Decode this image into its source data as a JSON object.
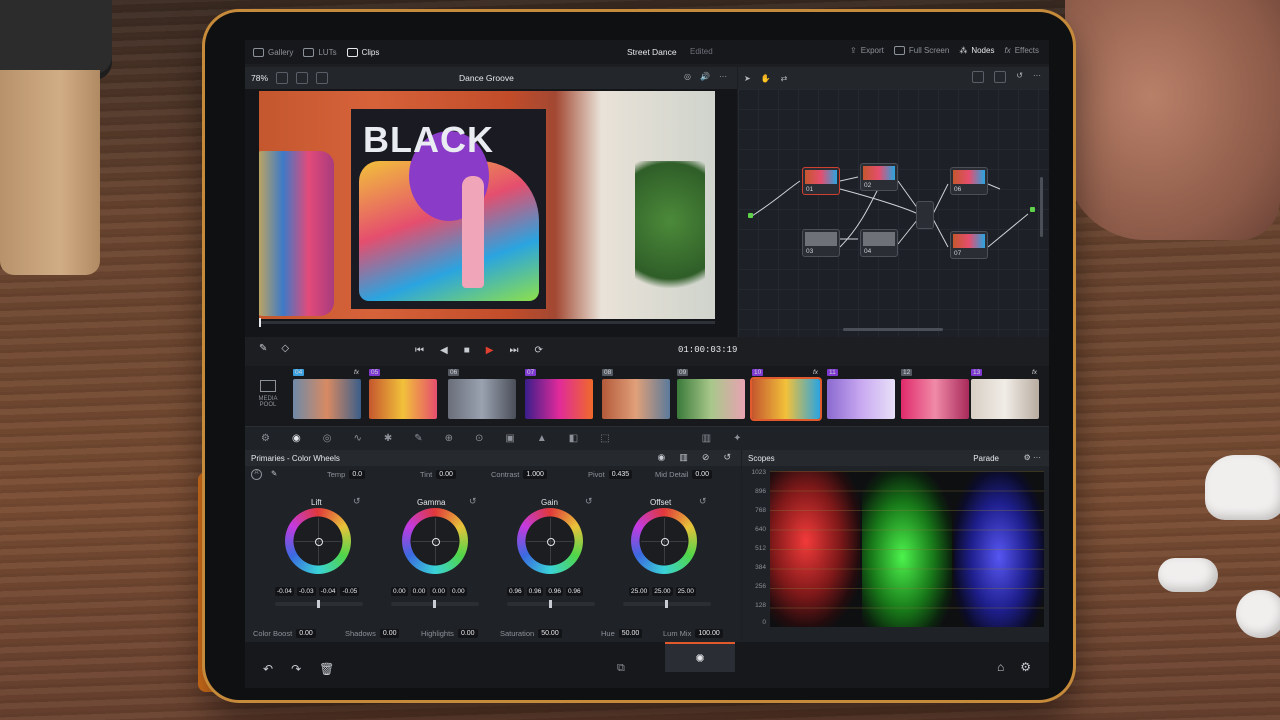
{
  "topbar": {
    "gallery": "Gallery",
    "luts": "LUTs",
    "clips": "Clips",
    "project_title": "Street Dance",
    "status": "Edited",
    "export": "Export",
    "fullscreen": "Full Screen",
    "nodes": "Nodes",
    "effects": "Effects"
  },
  "viewer": {
    "zoom": "78%",
    "clip_name": "Dance Groove",
    "timecode": "01:00:03:19",
    "mural_text": "BLACK"
  },
  "node_graph": {
    "nodes": [
      "01",
      "02",
      "03",
      "04",
      "06",
      "07"
    ]
  },
  "clips": [
    {
      "num": "04",
      "fx": "fx",
      "color": "#3aa0e0"
    },
    {
      "num": "05",
      "fx": "",
      "color": "#7e3ad0"
    },
    {
      "num": "06",
      "fx": "",
      "color": "#555a62"
    },
    {
      "num": "07",
      "fx": "",
      "color": "#7e3ad0"
    },
    {
      "num": "08",
      "fx": "",
      "color": "#555a62"
    },
    {
      "num": "09",
      "fx": "",
      "color": "#555a62"
    },
    {
      "num": "10",
      "fx": "fx",
      "color": "#7e3ad0"
    },
    {
      "num": "11",
      "fx": "",
      "color": "#7e3ad0"
    },
    {
      "num": "12",
      "fx": "",
      "color": "#555a62"
    },
    {
      "num": "13",
      "fx": "fx",
      "color": "#7e3ad0"
    }
  ],
  "strip_label": "MEDIA POOL",
  "primaries": {
    "title": "Primaries - Color Wheels",
    "temp_label": "Temp",
    "temp": "0.0",
    "tint_label": "Tint",
    "tint": "0.00",
    "contrast_label": "Contrast",
    "contrast": "1.000",
    "pivot_label": "Pivot",
    "pivot": "0.435",
    "middetail_label": "Mid Detail",
    "middetail": "0.00",
    "wheels": [
      {
        "label": "Lift",
        "values": [
          "-0.04",
          "-0.03",
          "-0.04",
          "-0.05"
        ]
      },
      {
        "label": "Gamma",
        "values": [
          "0.00",
          "0.00",
          "0.00",
          "0.00"
        ]
      },
      {
        "label": "Gain",
        "values": [
          "0.96",
          "0.96",
          "0.96",
          "0.96"
        ]
      },
      {
        "label": "Offset",
        "values": [
          "25.00",
          "25.00",
          "25.00"
        ]
      }
    ],
    "colorboost_label": "Color Boost",
    "colorboost": "0.00",
    "shadows_label": "Shadows",
    "shadows": "0.00",
    "highlights_label": "Highlights",
    "highlights": "0.00",
    "saturation_label": "Saturation",
    "saturation": "50.00",
    "hue_label": "Hue",
    "hue": "50.00",
    "lummix_label": "Lum Mix",
    "lummix": "100.00"
  },
  "scopes": {
    "title": "Scopes",
    "mode": "Parade",
    "ticks": [
      "1023",
      "896",
      "768",
      "640",
      "512",
      "384",
      "256",
      "128",
      "0"
    ]
  }
}
